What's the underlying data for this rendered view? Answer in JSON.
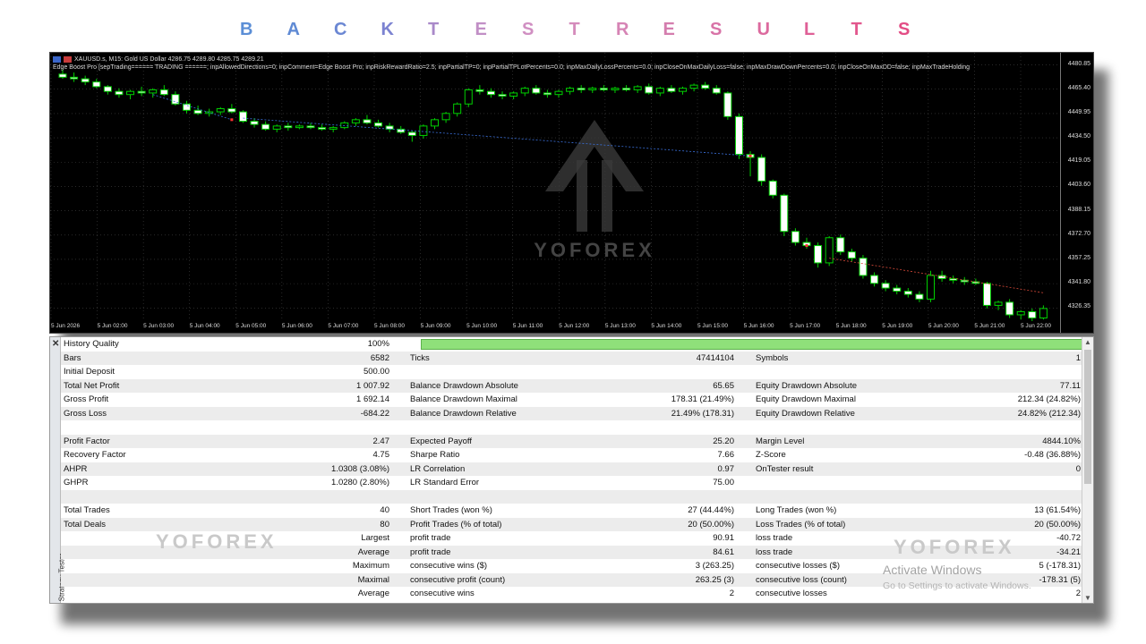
{
  "banner": {
    "letters": [
      "B",
      "A",
      "C",
      "K",
      "T",
      "E",
      "S",
      "T",
      "R",
      "E",
      "S",
      "U",
      "L",
      "T",
      "S"
    ],
    "colors": [
      "#5b8ed6",
      "#5f8ad4",
      "#6b87d3",
      "#7c83d1",
      "#a989c9",
      "#c18fc6",
      "#d08fc2",
      "#d58cbc",
      "#d684b5",
      "#d47dae",
      "#d873a7",
      "#dc6a9e",
      "#df6097",
      "#e2578d",
      "#e34d85"
    ]
  },
  "chart": {
    "symbol_line": "XAUUSD.s, M15:  Gold US Dollar  4286.75 4289.80 4285.75 4289.21",
    "params_line": "Edge Boost Pro [sepTrading====== TRADING ======; inpAllowedDirections=0; inpComment=Edge Boost Pro; inpRiskRewardRatio=2.5; inpPartialTP=0; inpPartialTPLotPercents=0.0; inpMaxDailyLossPercents=0.0; inpCloseOnMaxDailyLoss=false; inpMaxDrawDownPercents=0.0; inpCloseOnMaxDD=false; inpMaxTradeHolding",
    "y_ticks": [
      "4480.85",
      "4465.40",
      "4449.95",
      "4434.50",
      "4419.05",
      "4403.60",
      "4388.15",
      "4372.70",
      "4357.25",
      "4341.80",
      "4326.35"
    ],
    "x_ticks": [
      "5 Jun 2026",
      "5 Jun 02:00",
      "5 Jun 03:00",
      "5 Jun 04:00",
      "5 Jun 05:00",
      "5 Jun 06:00",
      "5 Jun 07:00",
      "5 Jun 08:00",
      "5 Jun 09:00",
      "5 Jun 10:00",
      "5 Jun 11:00",
      "5 Jun 12:00",
      "5 Jun 13:00",
      "5 Jun 14:00",
      "5 Jun 15:00",
      "5 Jun 16:00",
      "5 Jun 17:00",
      "5 Jun 18:00",
      "5 Jun 19:00",
      "5 Jun 20:00",
      "5 Jun 21:00",
      "5 Jun 22:00"
    ],
    "watermark": "YOFOREX"
  },
  "chart_data": {
    "type": "candlestick",
    "ylim": [
      4318,
      4484
    ],
    "candles": [
      [
        4475,
        4478,
        4472,
        4473
      ],
      [
        4473,
        4476,
        4470,
        4472
      ],
      [
        4472,
        4474,
        4468,
        4470
      ],
      [
        4470,
        4472,
        4466,
        4467
      ],
      [
        4467,
        4468,
        4462,
        4464
      ],
      [
        4464,
        4466,
        4460,
        4462
      ],
      [
        4462,
        4465,
        4459,
        4464
      ],
      [
        4464,
        4467,
        4461,
        4463
      ],
      [
        4463,
        4466,
        4460,
        4465
      ],
      [
        4465,
        4468,
        4461,
        4462
      ],
      [
        4462,
        4464,
        4455,
        4456
      ],
      [
        4456,
        4458,
        4450,
        4452
      ],
      [
        4452,
        4455,
        4449,
        4450
      ],
      [
        4450,
        4453,
        4448,
        4451
      ],
      [
        4451,
        4454,
        4449,
        4453
      ],
      [
        4453,
        4456,
        4450,
        4451
      ],
      [
        4451,
        4452,
        4444,
        4445
      ],
      [
        4445,
        4447,
        4441,
        4443
      ],
      [
        4443,
        4445,
        4439,
        4440
      ],
      [
        4440,
        4443,
        4438,
        4442
      ],
      [
        4442,
        4444,
        4439,
        4441
      ],
      [
        4441,
        4443,
        4440,
        4442
      ],
      [
        4442,
        4444,
        4440,
        4441
      ],
      [
        4441,
        4443,
        4439,
        4440
      ],
      [
        4440,
        4442,
        4438,
        4441
      ],
      [
        4441,
        4445,
        4440,
        4444
      ],
      [
        4444,
        4447,
        4442,
        4446
      ],
      [
        4446,
        4449,
        4443,
        4444
      ],
      [
        4444,
        4446,
        4441,
        4442
      ],
      [
        4442,
        4444,
        4438,
        4440
      ],
      [
        4440,
        4442,
        4437,
        4438
      ],
      [
        4438,
        4439,
        4432,
        4436
      ],
      [
        4436,
        4443,
        4434,
        4442
      ],
      [
        4442,
        4447,
        4440,
        4446
      ],
      [
        4446,
        4451,
        4444,
        4450
      ],
      [
        4450,
        4457,
        4448,
        4456
      ],
      [
        4456,
        4466,
        4454,
        4465
      ],
      [
        4465,
        4468,
        4462,
        4464
      ],
      [
        4464,
        4466,
        4460,
        4462
      ],
      [
        4462,
        4464,
        4459,
        4461
      ],
      [
        4461,
        4464,
        4459,
        4463
      ],
      [
        4463,
        4467,
        4461,
        4466
      ],
      [
        4466,
        4468,
        4462,
        4463
      ],
      [
        4463,
        4465,
        4460,
        4462
      ],
      [
        4462,
        4465,
        4460,
        4464
      ],
      [
        4464,
        4467,
        4462,
        4466
      ],
      [
        4466,
        4468,
        4463,
        4465
      ],
      [
        4465,
        4467,
        4463,
        4466
      ],
      [
        4466,
        4468,
        4464,
        4465
      ],
      [
        4465,
        4467,
        4463,
        4466
      ],
      [
        4466,
        4468,
        4464,
        4465
      ],
      [
        4465,
        4468,
        4463,
        4467
      ],
      [
        4467,
        4469,
        4462,
        4463
      ],
      [
        4463,
        4467,
        4461,
        4466
      ],
      [
        4466,
        4468,
        4463,
        4464
      ],
      [
        4464,
        4467,
        4462,
        4466
      ],
      [
        4466,
        4469,
        4464,
        4468
      ],
      [
        4468,
        4470,
        4465,
        4466
      ],
      [
        4466,
        4468,
        4462,
        4463
      ],
      [
        4463,
        4464,
        4446,
        4448
      ],
      [
        4448,
        4450,
        4421,
        4424
      ],
      [
        4424,
        4426,
        4410,
        4422
      ],
      [
        4422,
        4424,
        4404,
        4407
      ],
      [
        4407,
        4408,
        4396,
        4398
      ],
      [
        4398,
        4399,
        4372,
        4375
      ],
      [
        4375,
        4377,
        4366,
        4368
      ],
      [
        4368,
        4371,
        4364,
        4366
      ],
      [
        4366,
        4368,
        4352,
        4355
      ],
      [
        4355,
        4372,
        4353,
        4371
      ],
      [
        4371,
        4373,
        4360,
        4362
      ],
      [
        4362,
        4364,
        4356,
        4358
      ],
      [
        4358,
        4360,
        4345,
        4347
      ],
      [
        4347,
        4349,
        4340,
        4342
      ],
      [
        4342,
        4344,
        4337,
        4339
      ],
      [
        4339,
        4341,
        4335,
        4337
      ],
      [
        4337,
        4339,
        4333,
        4335
      ],
      [
        4335,
        4337,
        4330,
        4332
      ],
      [
        4332,
        4350,
        4330,
        4347
      ],
      [
        4347,
        4350,
        4343,
        4345
      ],
      [
        4345,
        4347,
        4342,
        4344
      ],
      [
        4344,
        4346,
        4341,
        4343
      ],
      [
        4343,
        4345,
        4341,
        4342
      ],
      [
        4342,
        4343,
        4326,
        4328
      ],
      [
        4328,
        4331,
        4325,
        4330
      ],
      [
        4330,
        4332,
        4320,
        4322
      ],
      [
        4322,
        4325,
        4319,
        4324
      ],
      [
        4324,
        4326,
        4318,
        4320
      ],
      [
        4320,
        4328,
        4319,
        4326
      ]
    ]
  },
  "report": {
    "history_quality_label": "History Quality",
    "history_quality_value": "100%",
    "history_quality_fraction": 1.0,
    "rows": [
      {
        "l1": "Bars",
        "v1": "6582",
        "l2": "Ticks",
        "v2": "47414104",
        "l3": "Symbols",
        "v3": "1"
      },
      {
        "l1": "Initial Deposit",
        "v1": "500.00",
        "l2": "",
        "v2": "",
        "l3": "",
        "v3": ""
      },
      {
        "l1": "Total Net Profit",
        "v1": "1 007.92",
        "l2": "Balance Drawdown Absolute",
        "v2": "65.65",
        "l3": "Equity Drawdown Absolute",
        "v3": "77.11"
      },
      {
        "l1": "Gross Profit",
        "v1": "1 692.14",
        "l2": "Balance Drawdown Maximal",
        "v2": "178.31 (21.49%)",
        "l3": "Equity Drawdown Maximal",
        "v3": "212.34 (24.82%)"
      },
      {
        "l1": "Gross Loss",
        "v1": "-684.22",
        "l2": "Balance Drawdown Relative",
        "v2": "21.49% (178.31)",
        "l3": "Equity Drawdown Relative",
        "v3": "24.82% (212.34)"
      },
      {
        "l1": "",
        "v1": "",
        "l2": "",
        "v2": "",
        "l3": "",
        "v3": ""
      },
      {
        "l1": "Profit Factor",
        "v1": "2.47",
        "l2": "Expected Payoff",
        "v2": "25.20",
        "l3": "Margin Level",
        "v3": "4844.10%"
      },
      {
        "l1": "Recovery Factor",
        "v1": "4.75",
        "l2": "Sharpe Ratio",
        "v2": "7.66",
        "l3": "Z-Score",
        "v3": "-0.48 (36.88%)"
      },
      {
        "l1": "AHPR",
        "v1": "1.0308 (3.08%)",
        "l2": "LR Correlation",
        "v2": "0.97",
        "l3": "OnTester result",
        "v3": "0"
      },
      {
        "l1": "GHPR",
        "v1": "1.0280 (2.80%)",
        "l2": "LR Standard Error",
        "v2": "75.00",
        "l3": "",
        "v3": ""
      },
      {
        "l1": "",
        "v1": "",
        "l2": "",
        "v2": "",
        "l3": "",
        "v3": ""
      },
      {
        "l1": "Total Trades",
        "v1": "40",
        "l2": "Short Trades (won %)",
        "v2": "27 (44.44%)",
        "l3": "Long Trades (won %)",
        "v3": "13 (61.54%)"
      },
      {
        "l1": "Total Deals",
        "v1": "80",
        "l2": "Profit Trades (% of total)",
        "v2": "20 (50.00%)",
        "l3": "Loss Trades (% of total)",
        "v3": "20 (50.00%)"
      },
      {
        "l1": "",
        "v1": "Largest",
        "l2": "profit trade",
        "v2": "90.91",
        "l3": "loss trade",
        "v3": "-40.72"
      },
      {
        "l1": "",
        "v1": "Average",
        "l2": "profit trade",
        "v2": "84.61",
        "l3": "loss trade",
        "v3": "-34.21"
      },
      {
        "l1": "",
        "v1": "Maximum",
        "l2": "consecutive wins ($)",
        "v2": "3 (263.25)",
        "l3": "consecutive losses ($)",
        "v3": "5 (-178.31)"
      },
      {
        "l1": "",
        "v1": "Maximal",
        "l2": "consecutive profit (count)",
        "v2": "263.25 (3)",
        "l3": "consecutive loss (count)",
        "v3": "-178.31 (5)"
      },
      {
        "l1": "",
        "v1": "Average",
        "l2": "consecutive wins",
        "v2": "2",
        "l3": "consecutive losses",
        "v3": "2"
      }
    ],
    "side_label": "Strategy Tester",
    "close_glyph": "✕",
    "watermark": "YOFOREX",
    "activate_title": "Activate Windows",
    "activate_sub": "Go to Settings to activate Windows."
  }
}
